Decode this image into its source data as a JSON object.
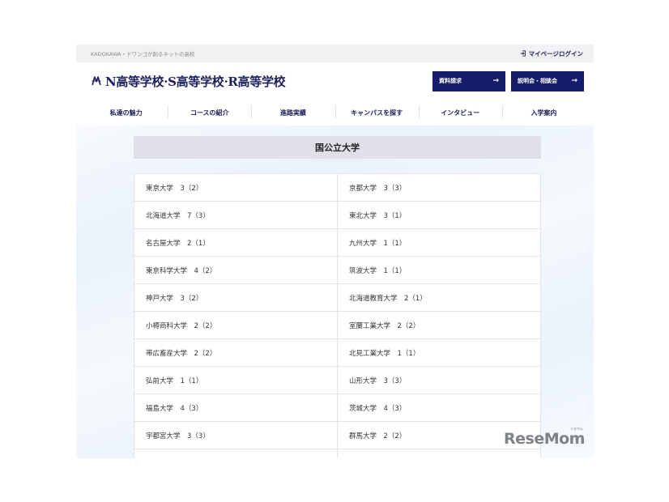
{
  "topbar": {
    "tagline": "KADOKAWA・ドワンゴが創るネットの高校",
    "login_label": "マイページログイン"
  },
  "header": {
    "logo_text": "N高等学校·S高等学校·R高等学校",
    "cta_docs": "資料請求",
    "cta_session": "説明会・相談会",
    "cta_arrow": "→"
  },
  "nav": {
    "items": [
      "私達の魅力",
      "コースの紹介",
      "進路実績",
      "キャンパスを探す",
      "インタビュー",
      "入学案内"
    ]
  },
  "section": {
    "title": "国公立大学"
  },
  "table": {
    "rows": [
      [
        "東京大学　3（2）",
        "京都大学　3（3）"
      ],
      [
        "北海道大学　7（3）",
        "東北大学　3（1）"
      ],
      [
        "名古屋大学　2（1）",
        "九州大学　1（1）"
      ],
      [
        "東京科学大学　4（2）",
        "筑波大学　1（1）"
      ],
      [
        "神戸大学　3（2）",
        "北海道教育大学　2（1）"
      ],
      [
        "小樽商科大学　2（2）",
        "室蘭工業大学　2（2）"
      ],
      [
        "帯広畜産大学　2（2）",
        "北見工業大学　1（1）"
      ],
      [
        "弘前大学　1（1）",
        "山形大学　3（3）"
      ],
      [
        "福島大学　4（3）",
        "茨城大学　4（3）"
      ],
      [
        "宇都宮大学　3（3）",
        "群馬大学　2（2）"
      ],
      [
        "",
        ""
      ]
    ]
  },
  "watermark": {
    "text": "ReseMom",
    "reading": "リセマム"
  },
  "colors": {
    "brand_navy": "#161c69",
    "section_bg": "#e0e1e8"
  }
}
